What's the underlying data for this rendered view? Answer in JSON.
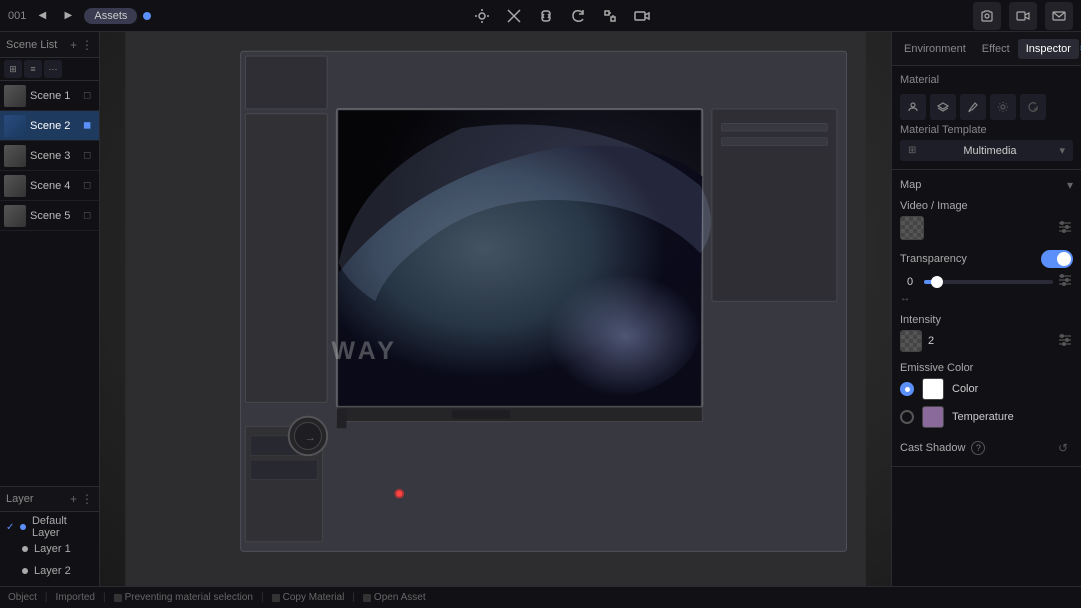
{
  "app": {
    "title": "001",
    "assets_button": "Assets"
  },
  "toolbar": {
    "tools": [
      "💡",
      "✂",
      "🔗",
      "↺",
      "↔",
      "📷"
    ]
  },
  "top_right": {
    "camera_icon": "📷",
    "video_icon": "📹",
    "mail_icon": "✉"
  },
  "scene_list": {
    "title": "Scene List",
    "items": [
      {
        "name": "Scene 1",
        "active": false
      },
      {
        "name": "Scene 2",
        "active": true
      },
      {
        "name": "Scene 3",
        "active": false
      },
      {
        "name": "Scene 4",
        "active": false
      },
      {
        "name": "Scene 5",
        "active": false
      }
    ]
  },
  "layers": {
    "title": "Layer",
    "items": [
      {
        "name": "Default Layer",
        "checked": true
      },
      {
        "name": "Layer 1",
        "checked": false
      },
      {
        "name": "Layer 2",
        "checked": false
      }
    ]
  },
  "right_panel": {
    "tabs": [
      {
        "label": "Environment",
        "active": false
      },
      {
        "label": "Effect",
        "active": false
      },
      {
        "label": "Inspector",
        "active": true
      }
    ],
    "material": {
      "section_title": "Material",
      "icons": [
        "person",
        "layers",
        "brush",
        "settings",
        "refresh"
      ],
      "template_label": "Material Template",
      "template_value": "Multimedia"
    },
    "map": {
      "section_title": "Map",
      "video_image_label": "Video / Image"
    },
    "transparency": {
      "label": "Transparency",
      "enabled": true,
      "value": "0"
    },
    "intensity": {
      "label": "Intensity",
      "value": "2"
    },
    "emissive_color": {
      "label": "Emissive Color",
      "color_option": {
        "label": "Color",
        "selected": true
      },
      "temperature_option": {
        "label": "Temperature",
        "selected": false
      }
    },
    "cast_shadow": {
      "label": "Cast Shadow"
    }
  },
  "status_bar": {
    "left": "Object",
    "middle": "Imported",
    "action1": "Preventing material selection",
    "action2": "Copy Material",
    "action3": "Open Asset"
  }
}
